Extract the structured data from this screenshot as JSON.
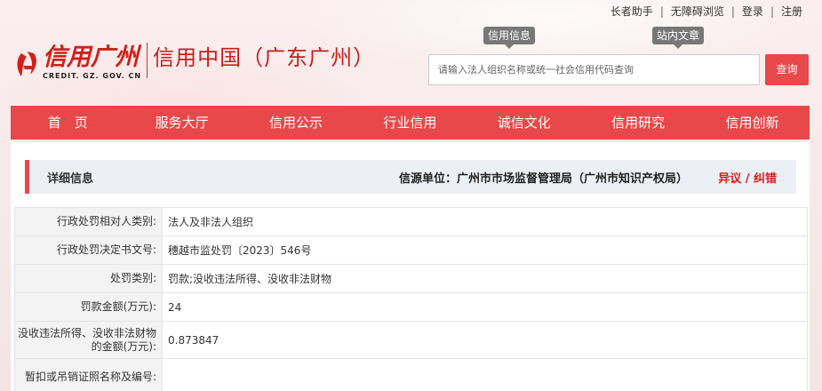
{
  "top_links": [
    "长者助手",
    "无障碍浏览",
    "登录",
    "注册"
  ],
  "logo": {
    "brand": "信用广州",
    "sub": "CREDIT. GZ. GOV. CN",
    "site_name": "信用中国（广东广州）"
  },
  "search": {
    "tabs": [
      "信用信息",
      "站内文章"
    ],
    "placeholder": "请输入法人组织名称或统一社会信用代码查询",
    "button": "查询"
  },
  "nav": [
    "首　页",
    "服务大厅",
    "信用公示",
    "行业信用",
    "诚信文化",
    "信用研究",
    "信用创新"
  ],
  "detail": {
    "title": "详细信息",
    "source": "信源单位：广州市市场监督管理局（广州市知识产权局）",
    "objection": "异议 / 纠错"
  },
  "rows": [
    {
      "label": "行政处罚相对人类别:",
      "value": "法人及非法人组织"
    },
    {
      "label": "行政处罚决定书文号:",
      "value": "穗越市监处罚〔2023〕546号"
    },
    {
      "label": "处罚类别:",
      "value": "罚款;没收违法所得、没收非法财物"
    },
    {
      "label": "罚款金额(万元):",
      "value": "24"
    },
    {
      "label": "没收违法所得、没收非法财物的金额(万元):",
      "value": "0.873847"
    },
    {
      "label": "暂扣或吊销证照名称及编号:",
      "value": ""
    }
  ],
  "colors": {
    "accent": "#e9484a",
    "brand_red": "#d0201a"
  }
}
